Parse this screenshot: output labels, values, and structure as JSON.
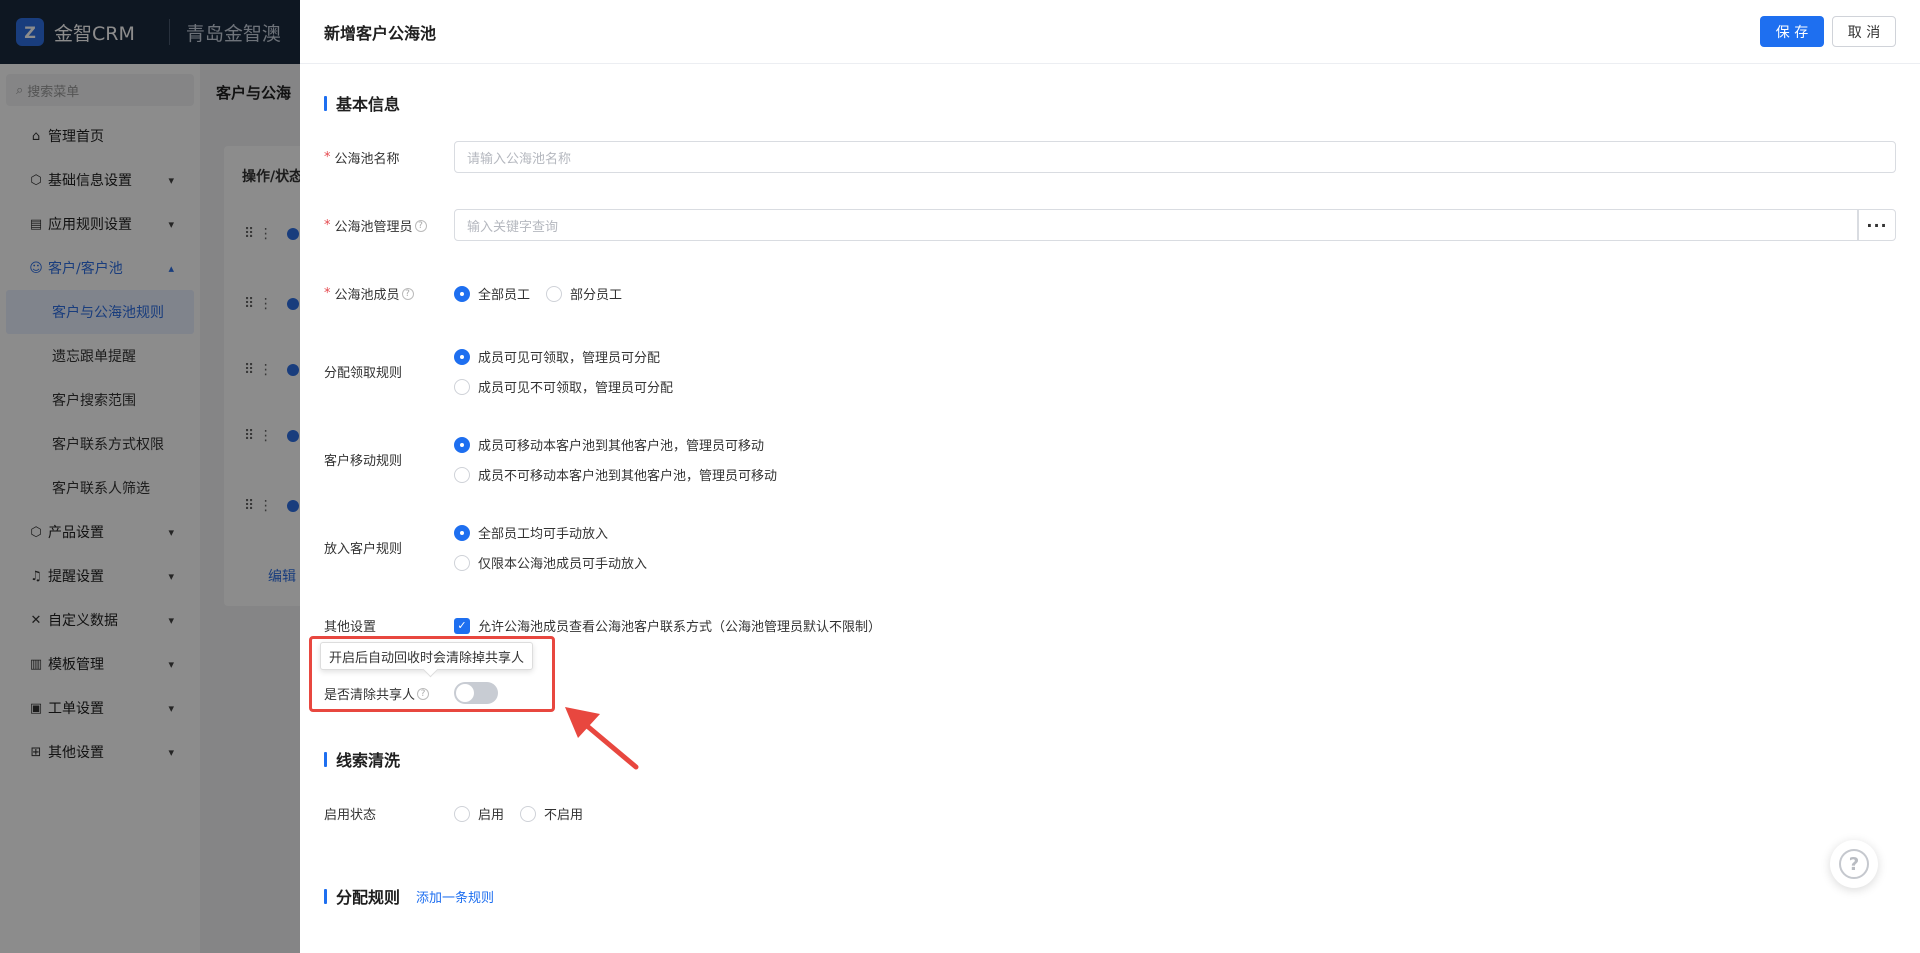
{
  "app": {
    "logo_text": "金智CRM",
    "company_name": "青岛金智澳"
  },
  "sidebar": {
    "search_placeholder": "搜索菜单",
    "items": [
      {
        "label": "管理首页",
        "icon": "home-icon"
      },
      {
        "label": "基础信息设置",
        "icon": "cube-icon"
      },
      {
        "label": "应用规则设置",
        "icon": "document-icon"
      },
      {
        "label": "客户/客户池",
        "icon": "customer-icon"
      },
      {
        "label": "产品设置",
        "icon": "cube-icon"
      },
      {
        "label": "提醒设置",
        "icon": "bell-icon"
      },
      {
        "label": "自定义数据",
        "icon": "tools-icon"
      },
      {
        "label": "模板管理",
        "icon": "template-icon"
      },
      {
        "label": "工单设置",
        "icon": "ticket-icon"
      },
      {
        "label": "其他设置",
        "icon": "grid-icon"
      }
    ],
    "sub_items": [
      "客户与公海池规则",
      "遗忘跟单提醒",
      "客户搜索范围",
      "客户联系方式权限",
      "客户联系人筛选"
    ]
  },
  "background": {
    "breadcrumb": "客户与公海",
    "table_header": "操作/状态",
    "edit_link": "编辑"
  },
  "drawer": {
    "title": "新增客户公海池",
    "save_label": "保 存",
    "cancel_label": "取 消",
    "sections": {
      "basic_info": "基本信息",
      "lead_cleaning": "线索清洗",
      "distribution_rules": "分配规则",
      "add_rule_link": "添加一条规则"
    },
    "fields": {
      "pool_name": {
        "label": "公海池名称",
        "placeholder": "请输入公海池名称"
      },
      "pool_admin": {
        "label": "公海池管理员",
        "placeholder": "输入关键字查询",
        "button": "···"
      },
      "pool_members": {
        "label": "公海池成员",
        "options": [
          "全部员工",
          "部分员工"
        ],
        "selected": "全部员工"
      },
      "claim_rule": {
        "label": "分配领取规则",
        "options": [
          "成员可见可领取，管理员可分配",
          "成员可见不可领取，管理员可分配"
        ],
        "selected": "成员可见可领取，管理员可分配"
      },
      "move_rule": {
        "label": "客户移动规则",
        "options": [
          "成员可移动本客户池到其他客户池，管理员可移动",
          "成员不可移动本客户池到其他客户池，管理员可移动"
        ],
        "selected": "成员可移动本客户池到其他客户池，管理员可移动"
      },
      "put_in_rule": {
        "label": "放入客户规则",
        "options": [
          "全部员工均可手动放入",
          "仅限本公海池成员可手动放入"
        ],
        "selected": "全部员工均可手动放入"
      },
      "other_settings": {
        "label": "其他设置",
        "checkbox_label": "允许公海池成员查看公海池客户联系方式（公海池管理员默认不限制）",
        "checked": true
      },
      "clear_sharers": {
        "label": "是否清除共享人",
        "tooltip": "开启后自动回收时会清除掉共享人",
        "enabled": false
      },
      "enable_status": {
        "label": "启用状态",
        "options": [
          "启用",
          "不启用"
        ],
        "selected": null
      }
    }
  },
  "colors": {
    "primary": "#1e6ff0",
    "highlight": "#e8473f",
    "topbar": "#1b2a3f"
  }
}
